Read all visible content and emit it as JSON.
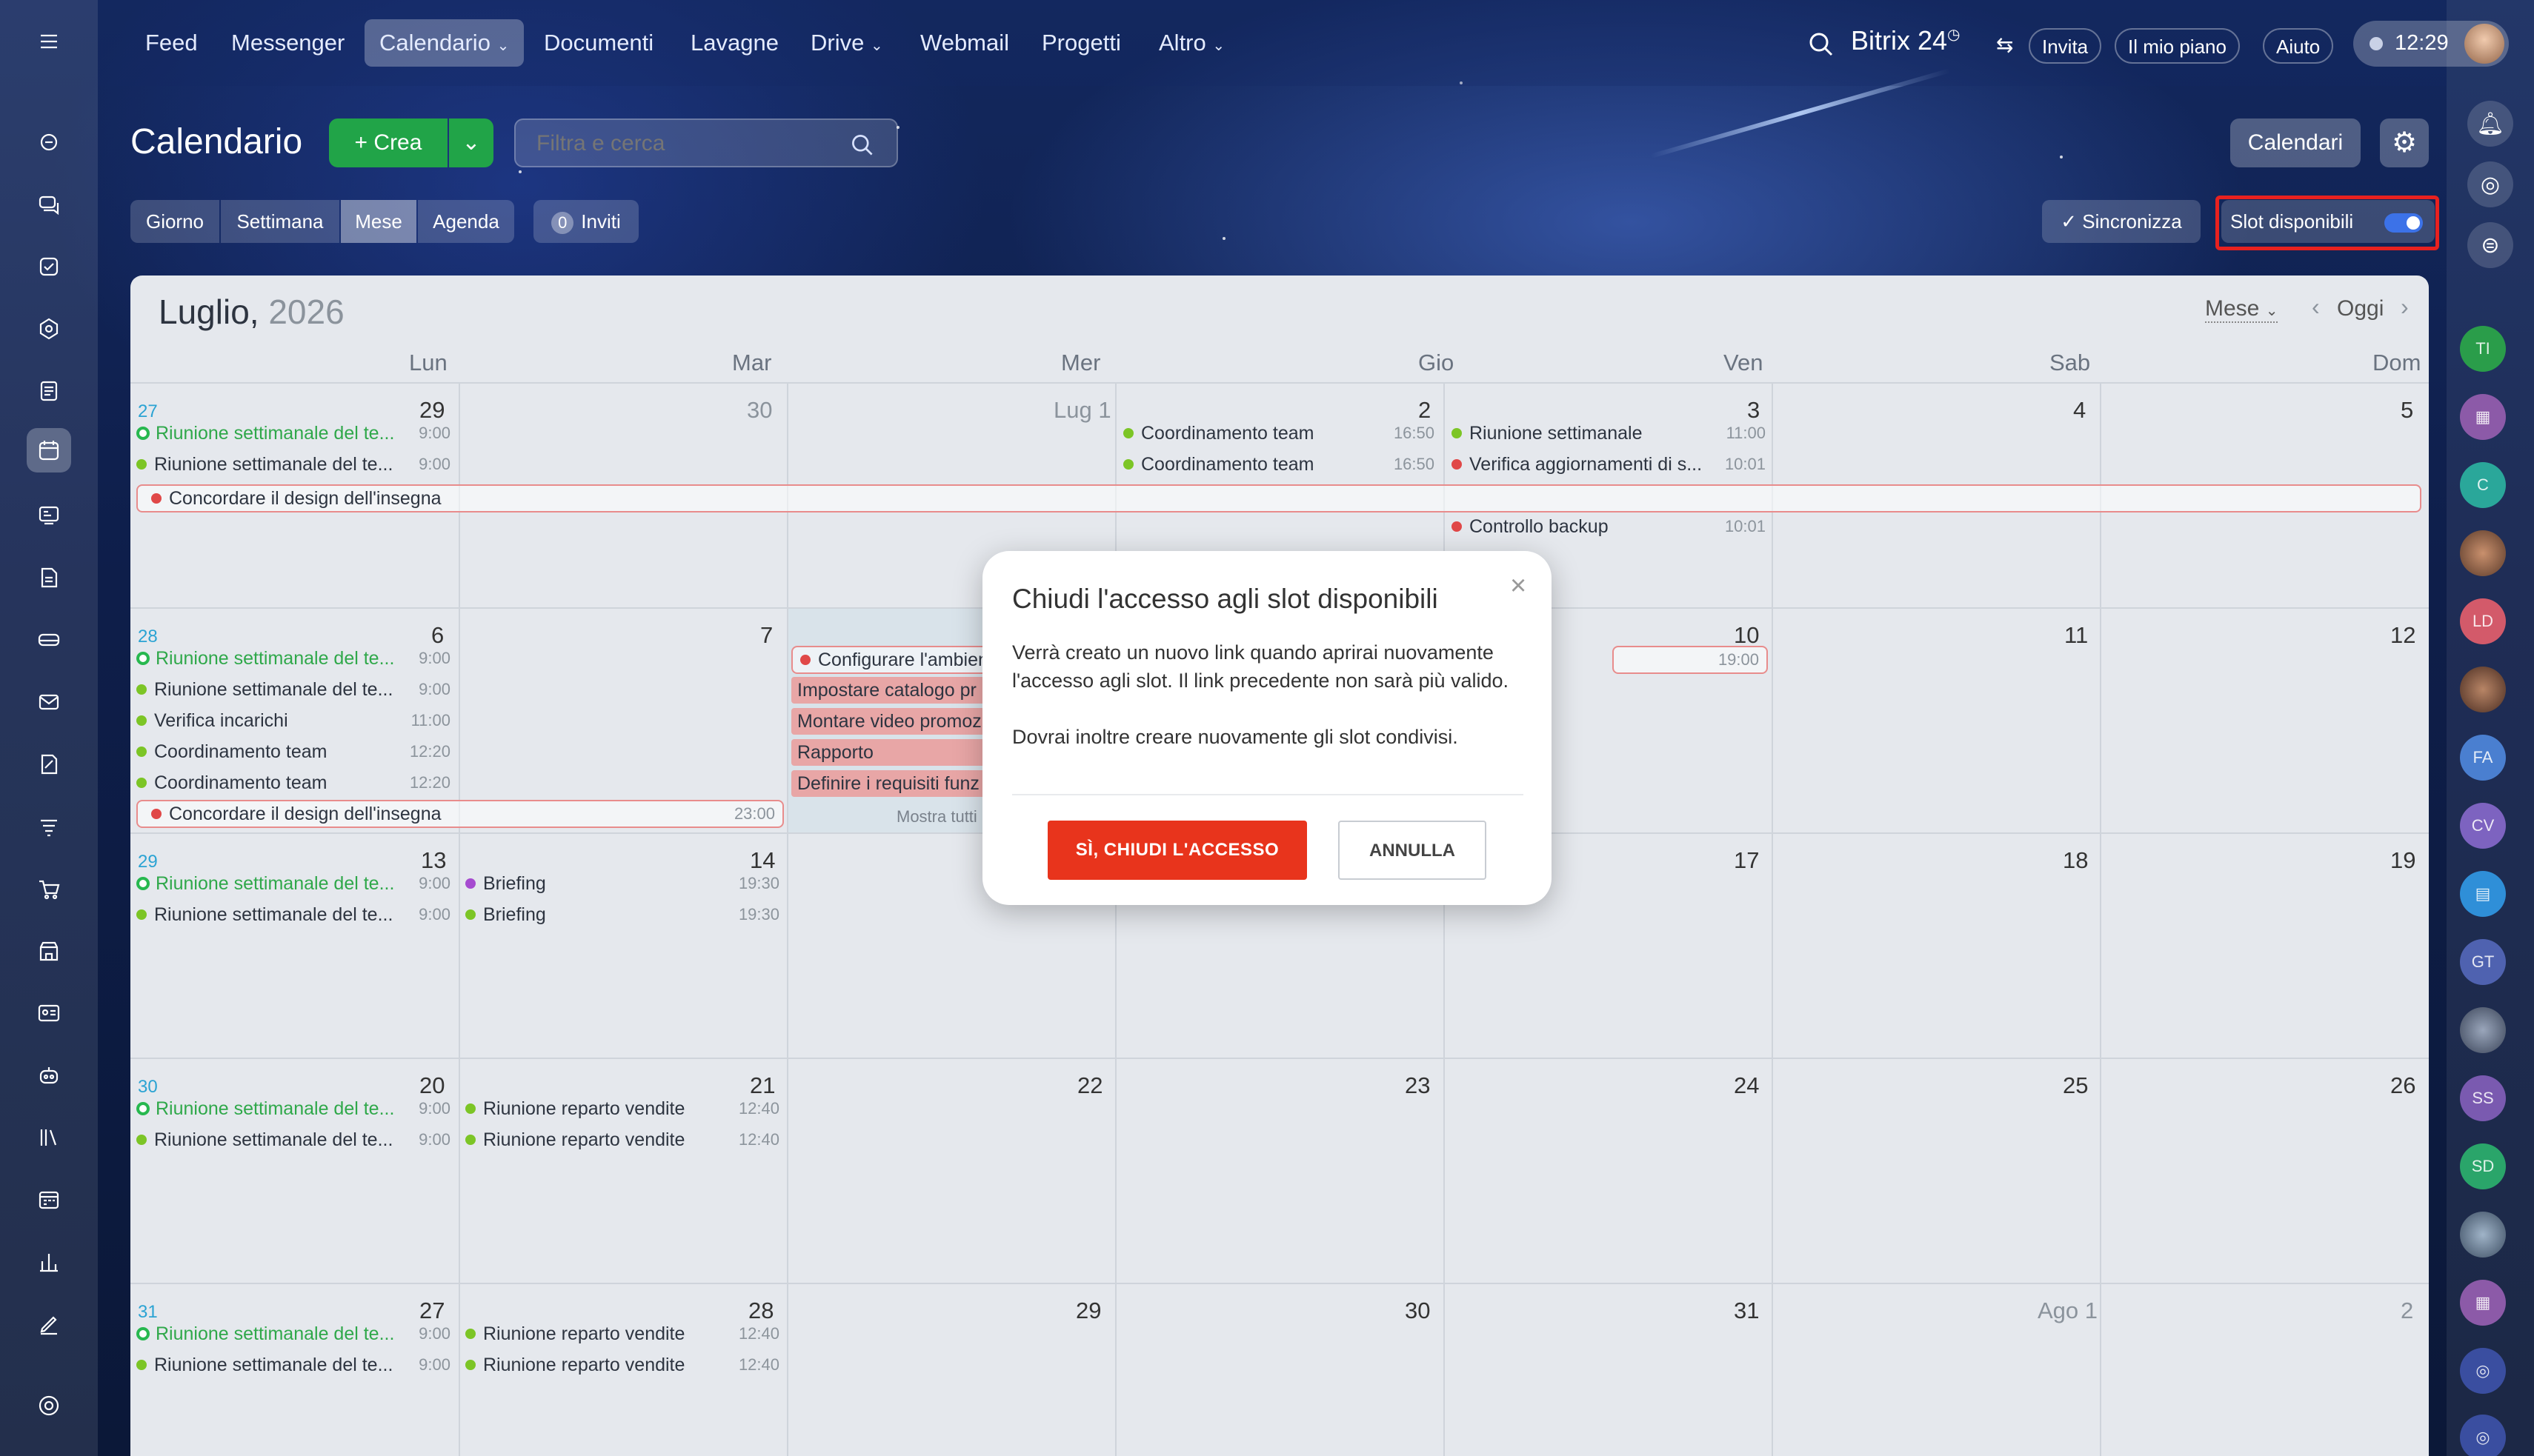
{
  "nav": {
    "items": [
      "Feed",
      "Messenger",
      "Calendario",
      "Documenti",
      "Lavagne",
      "Drive",
      "Webmail",
      "Progetti",
      "Altro"
    ],
    "brand": "Bitrix 24",
    "invite": "Invita",
    "plan": "Il mio piano",
    "help": "Aiuto",
    "time": "12:29"
  },
  "header": {
    "title": "Calendario",
    "create": "Crea",
    "search_placeholder": "Filtra e cerca",
    "calendars": "Calendari"
  },
  "views": {
    "day": "Giorno",
    "week": "Settimana",
    "month": "Mese",
    "agenda": "Agenda"
  },
  "invites": {
    "count": "0",
    "label": "Inviti"
  },
  "sync": "Sincronizza",
  "slots": {
    "label": "Slot disponibili",
    "enabled": true
  },
  "calendar": {
    "month": "Luglio,",
    "year": "2026",
    "view_select": "Mese",
    "today": "Oggi",
    "weekdays": [
      "Lun",
      "Mar",
      "Mer",
      "Gio",
      "Ven",
      "Sab",
      "Dom"
    ],
    "weeks": [
      {
        "num": "27",
        "days": [
          "29",
          "30",
          "Lug 1",
          "2",
          "3",
          "4",
          "5"
        ]
      },
      {
        "num": "28",
        "days": [
          "6",
          "7",
          "8",
          "9",
          "10",
          "11",
          "12"
        ]
      },
      {
        "num": "29",
        "days": [
          "13",
          "14",
          "15",
          "16",
          "17",
          "18",
          "19"
        ]
      },
      {
        "num": "30",
        "days": [
          "20",
          "21",
          "22",
          "23",
          "24",
          "25",
          "26"
        ]
      },
      {
        "num": "31",
        "days": [
          "27",
          "28",
          "29",
          "30",
          "31",
          "Ago 1",
          "2"
        ]
      }
    ],
    "events": {
      "w1": [
        {
          "t": "Riunione settimanale del te...",
          "time": "9:00"
        },
        {
          "t": "Riunione settimanale del te...",
          "time": "9:00"
        },
        {
          "t": "Coordinamento team",
          "time": "16:50"
        },
        {
          "t": "Coordinamento team",
          "time": "16:50"
        },
        {
          "t": "Riunione settimanale",
          "time": "11:00"
        },
        {
          "t": "Verifica aggiornamenti di s...",
          "time": "10:01"
        },
        {
          "t": "Controllo backup",
          "time": "10:01"
        }
      ],
      "w1_band": "Concordare il design dell'insegna",
      "w2": [
        {
          "t": "Riunione settimanale del te...",
          "time": "9:00"
        },
        {
          "t": "Riunione settimanale del te...",
          "time": "9:00"
        },
        {
          "t": "Verifica incarichi",
          "time": "11:00"
        },
        {
          "t": "Coordinamento team",
          "time": "12:20"
        },
        {
          "t": "Coordinamento team",
          "time": "12:20"
        }
      ],
      "w2_band": "Concordare il design dell'insegna",
      "w2_band_time": "23:00",
      "w2_wed": [
        "Configurare l'ambiente",
        "Impostare catalogo pr",
        "Montare video promoz",
        "Rapporto",
        "Definire i requisiti funz"
      ],
      "w2_more": "Mostra tutti",
      "w2_fri_time": "19:00",
      "w3": [
        {
          "t": "Riunione settimanale del te...",
          "time": "9:00"
        },
        {
          "t": "Riunione settimanale del te...",
          "time": "9:00"
        },
        {
          "t": "Briefing",
          "time": "19:30"
        },
        {
          "t": "Briefing",
          "time": "19:30"
        }
      ],
      "w4": [
        {
          "t": "Riunione settimanale del te...",
          "time": "9:00"
        },
        {
          "t": "Riunione settimanale del te...",
          "time": "9:00"
        },
        {
          "t": "Riunione reparto vendite",
          "time": "12:40"
        },
        {
          "t": "Riunione reparto vendite",
          "time": "12:40"
        }
      ],
      "w5": [
        {
          "t": "Riunione settimanale del te...",
          "time": "9:00"
        },
        {
          "t": "Riunione settimanale del te...",
          "time": "9:00"
        },
        {
          "t": "Riunione reparto vendite",
          "time": "12:40"
        },
        {
          "t": "Riunione reparto vendite",
          "time": "12:40"
        }
      ]
    }
  },
  "dialog": {
    "title": "Chiudi l'accesso agli slot disponibili",
    "body1": "Verrà creato un nuovo link quando aprirai nuovamente l'accesso agli slot. Il link precedente non sarà più valido.",
    "body2": "Dovrai inoltre creare nuovamente gli slot condivisi.",
    "confirm": "SÌ, CHIUDI L'ACCESSO",
    "cancel": "ANNULLA"
  },
  "right_avatars": [
    "TI",
    "C",
    "LD",
    "FA",
    "CV",
    "GT",
    "SS",
    "SD"
  ],
  "colors": {
    "green": "#27b84f",
    "red": "#e04848",
    "purple": "#a64bd0",
    "accent": "#e8341c",
    "toggle": "#3c72e8"
  }
}
